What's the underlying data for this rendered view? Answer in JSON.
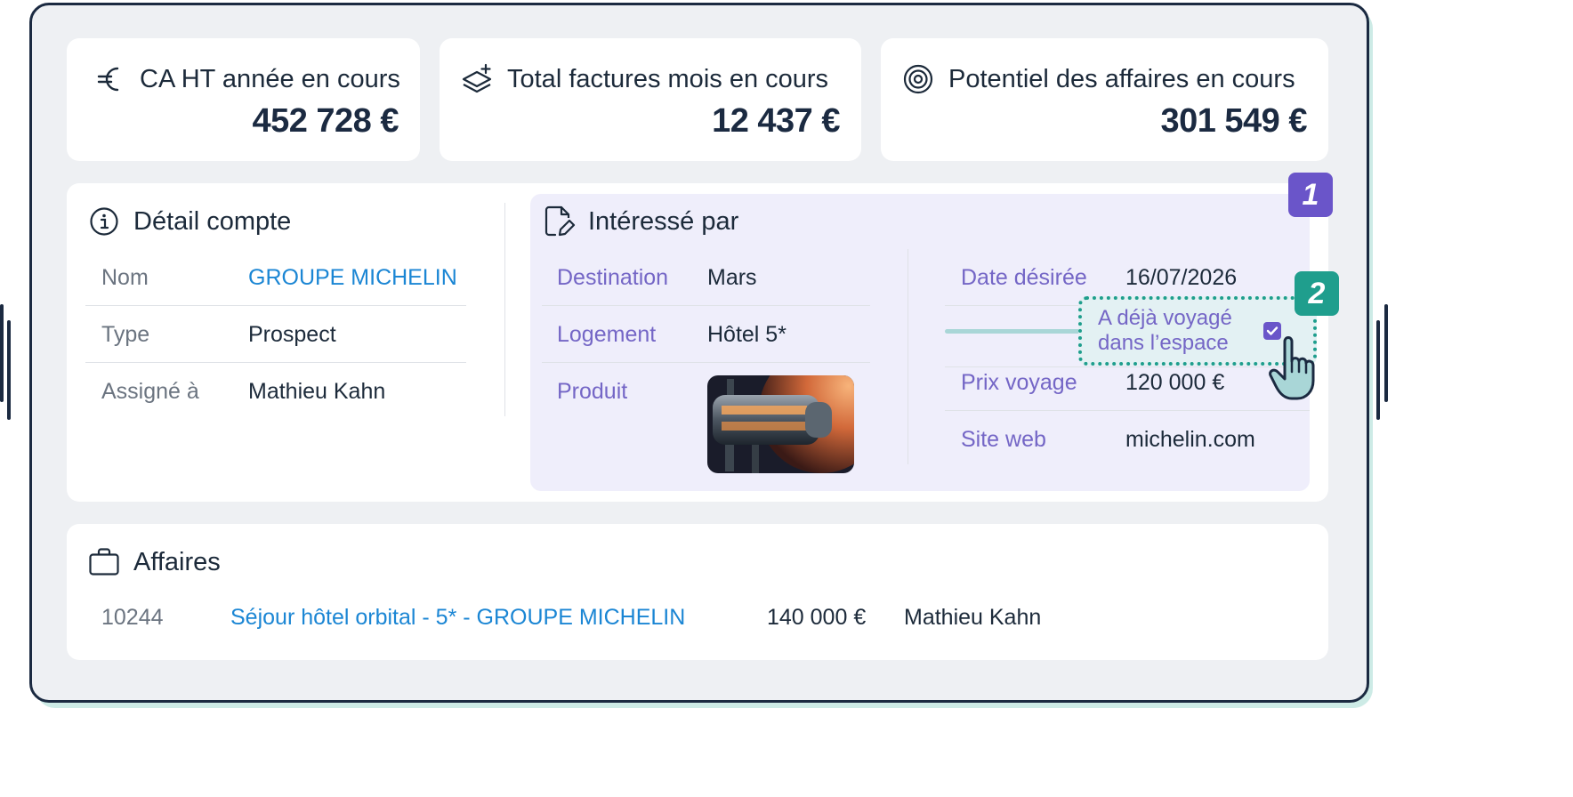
{
  "stats": [
    {
      "icon": "euro-icon",
      "label": "CA HT année en cours",
      "value": "452 728 €"
    },
    {
      "icon": "layers-plus-icon",
      "label": "Total factures mois en cours",
      "value": "12 437 €"
    },
    {
      "icon": "target-icon",
      "label": "Potentiel des affaires en cours",
      "value": "301 549 €"
    }
  ],
  "account": {
    "title": "Détail compte",
    "rows": [
      {
        "label": "Nom",
        "value": "GROUPE MICHELIN"
      },
      {
        "label": "Type",
        "value": "Prospect"
      },
      {
        "label": "Assigné à",
        "value": "Mathieu Kahn"
      }
    ]
  },
  "interest": {
    "title": "Intéressé par",
    "left": [
      {
        "label": "Destination",
        "value": "Mars"
      },
      {
        "label": "Logement",
        "value": "Hôtel 5*"
      },
      {
        "label": "Produit",
        "value": ""
      }
    ],
    "right": [
      {
        "label": "Date désirée",
        "value": "16/07/2026"
      },
      {
        "label": "Prix voyage",
        "value": "120 000 €"
      },
      {
        "label": "Site web",
        "value": "michelin.com"
      }
    ],
    "checkbox_line1": "A déjà voyagé",
    "checkbox_line2": "dans l’espace",
    "checkbox_checked": true
  },
  "badges": [
    "1",
    "2"
  ],
  "deals": {
    "title": "Affaires",
    "rows": [
      {
        "id": "10244",
        "name": "Séjour hôtel orbital - 5* - GROUPE MICHELIN",
        "amount": "140 000 €",
        "owner": "Mathieu Kahn"
      }
    ]
  },
  "colors": {
    "navy": "#1b2a41",
    "violet": "#6a55c9",
    "teal": "#1f9e8d",
    "link": "#1b86d4",
    "lavender": "#efeefb"
  }
}
